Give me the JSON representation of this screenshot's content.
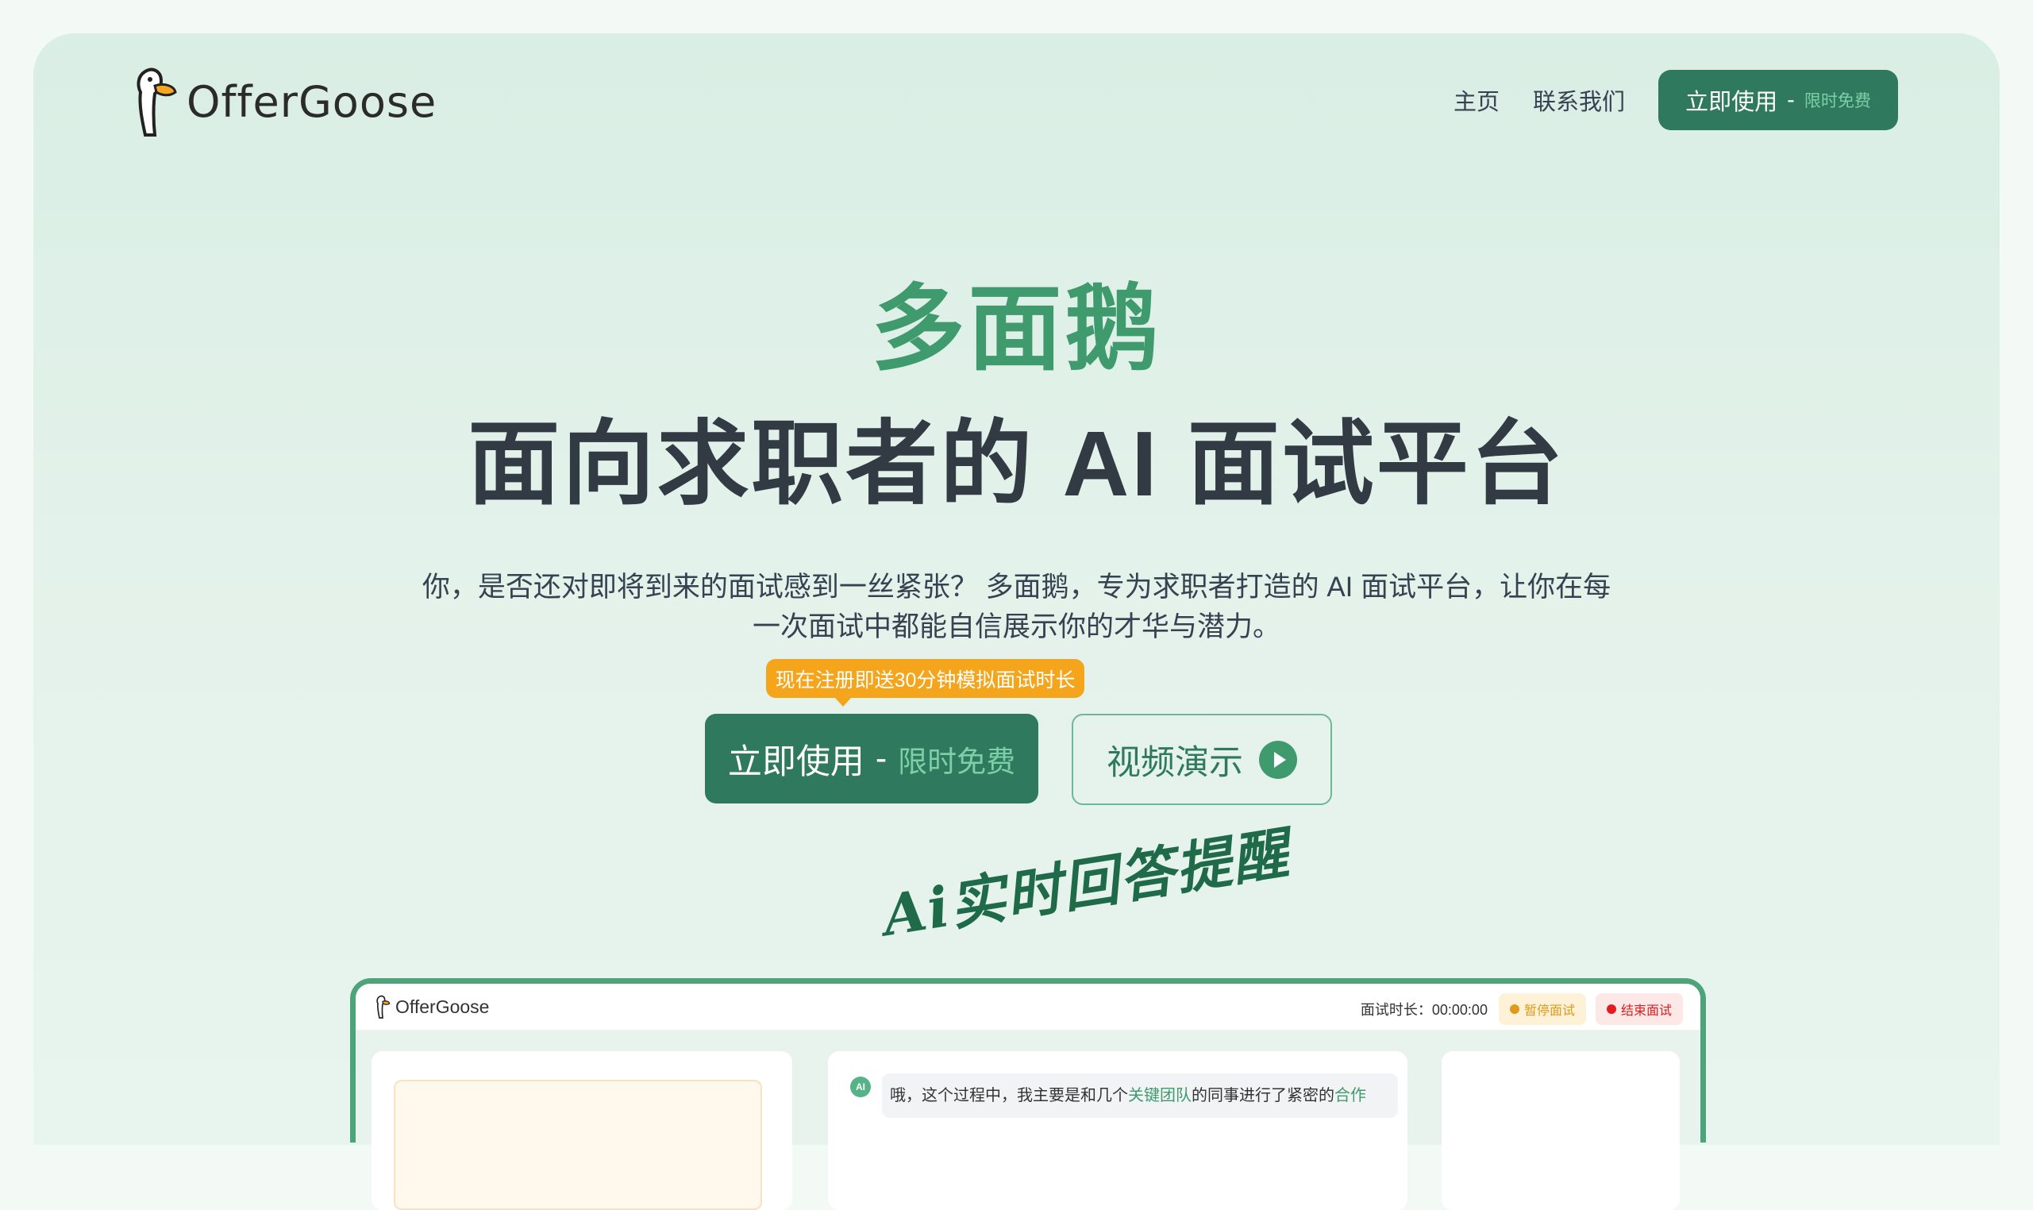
{
  "header": {
    "logo_text": "OfferGoose",
    "nav_links": [
      "主页",
      "联系我们"
    ],
    "cta_label": "立即使用",
    "cta_separator": "-",
    "cta_sub": "限时免费"
  },
  "hero": {
    "brand": "多面鹅",
    "title": "面向求职者的 AI 面试平台",
    "description_line1": "你，是否还对即将到来的面试感到一丝紧张？ 多面鹅，专为求职者打造的 AI 面试平台，让你在每",
    "description_line2": "一次面试中都能自信展示你的才华与潜力。",
    "promo_tag": "现在注册即送30分钟模拟面试时长",
    "primary_button_label": "立即使用",
    "primary_button_separator": "-",
    "primary_button_sub": "限时免费",
    "video_button_label": "视频演示",
    "script_annotation": "Ai实时回答提醒"
  },
  "demo": {
    "logo_text": "OfferGoose",
    "timer_label": "面试时长：00:00:00",
    "pause_label": "暂停面试",
    "end_label": "结束面试",
    "ai_badge": "AI",
    "message_part1": "哦，这个过程中，我主要是和几个",
    "message_highlight1": "关键团队",
    "message_part2": "的同事进行了紧密的",
    "message_highlight2": "合作",
    "colors": {
      "brand_green": "#2f7a5e",
      "accent_green": "#3f9a6e",
      "promo_orange": "#f4a51c",
      "end_red": "#e11d1d"
    }
  }
}
